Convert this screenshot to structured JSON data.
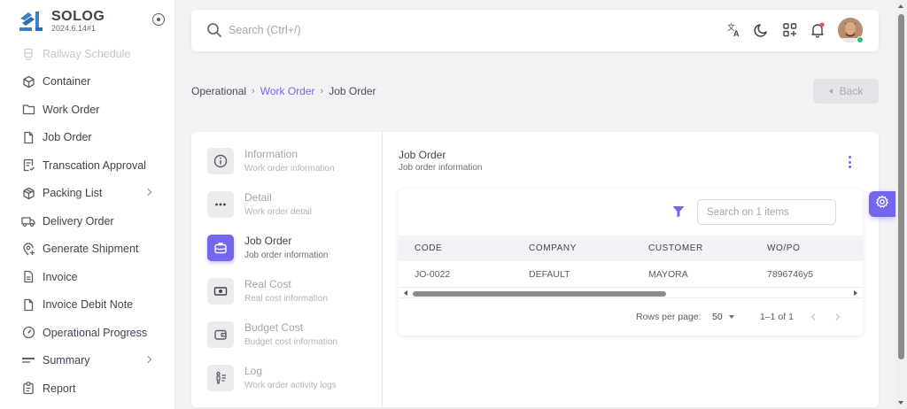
{
  "brand": {
    "name": "SOLOG",
    "version": "2024.6.14#1"
  },
  "sidebar": {
    "items": [
      {
        "label": "Railway Schedule",
        "icon": "train-icon"
      },
      {
        "label": "Container",
        "icon": "box-icon"
      },
      {
        "label": "Work Order",
        "icon": "folder-icon"
      },
      {
        "label": "Job Order",
        "icon": "file-icon"
      },
      {
        "label": "Transcation Approval",
        "icon": "file-check-icon"
      },
      {
        "label": "Packing List",
        "icon": "package-icon"
      },
      {
        "label": "Delivery Order",
        "icon": "truck-icon"
      },
      {
        "label": "Generate Shipment",
        "icon": "map-pin-plus-icon"
      },
      {
        "label": "Invoice",
        "icon": "invoice-icon"
      },
      {
        "label": "Invoice Debit Note",
        "icon": "file-icon"
      },
      {
        "label": "Operational Progress",
        "icon": "gauge-icon"
      },
      {
        "label": "Summary",
        "icon": "dash-icon"
      },
      {
        "label": "Report",
        "icon": "report-icon"
      }
    ]
  },
  "topbar": {
    "search_placeholder": "Search (Ctrl+/)"
  },
  "breadcrumb": {
    "root": "Operational",
    "parent": "Work Order",
    "current": "Job Order"
  },
  "back_label": "Back",
  "steps": [
    {
      "title": "Information",
      "subtitle": "Work order information",
      "icon": "info-icon"
    },
    {
      "title": "Detail",
      "subtitle": "Work order detail",
      "icon": "dots-icon"
    },
    {
      "title": "Job Order",
      "subtitle": "Job order information",
      "icon": "briefcase-icon",
      "active": true
    },
    {
      "title": "Real Cost",
      "subtitle": "Real cost information",
      "icon": "cash-icon"
    },
    {
      "title": "Budget Cost",
      "subtitle": "Budget cost information",
      "icon": "wallet-icon"
    },
    {
      "title": "Log",
      "subtitle": "Work order activity logs",
      "icon": "log-icon"
    }
  ],
  "section": {
    "title": "Job Order",
    "subtitle": "Job order information"
  },
  "table": {
    "search_placeholder": "Search on 1 items",
    "columns": [
      "CODE",
      "COMPANY",
      "CUSTOMER",
      "WO/PO"
    ],
    "rows": [
      [
        "JO-0022",
        "DEFAULT",
        "MAYORA",
        "7896746y5"
      ]
    ],
    "rows_per_page_label": "Rows per page:",
    "rows_per_page": "50",
    "range": "1–1 of 1"
  },
  "colors": {
    "primary": "#7367f0",
    "online": "#28c76f",
    "notification": "#ea5455"
  }
}
